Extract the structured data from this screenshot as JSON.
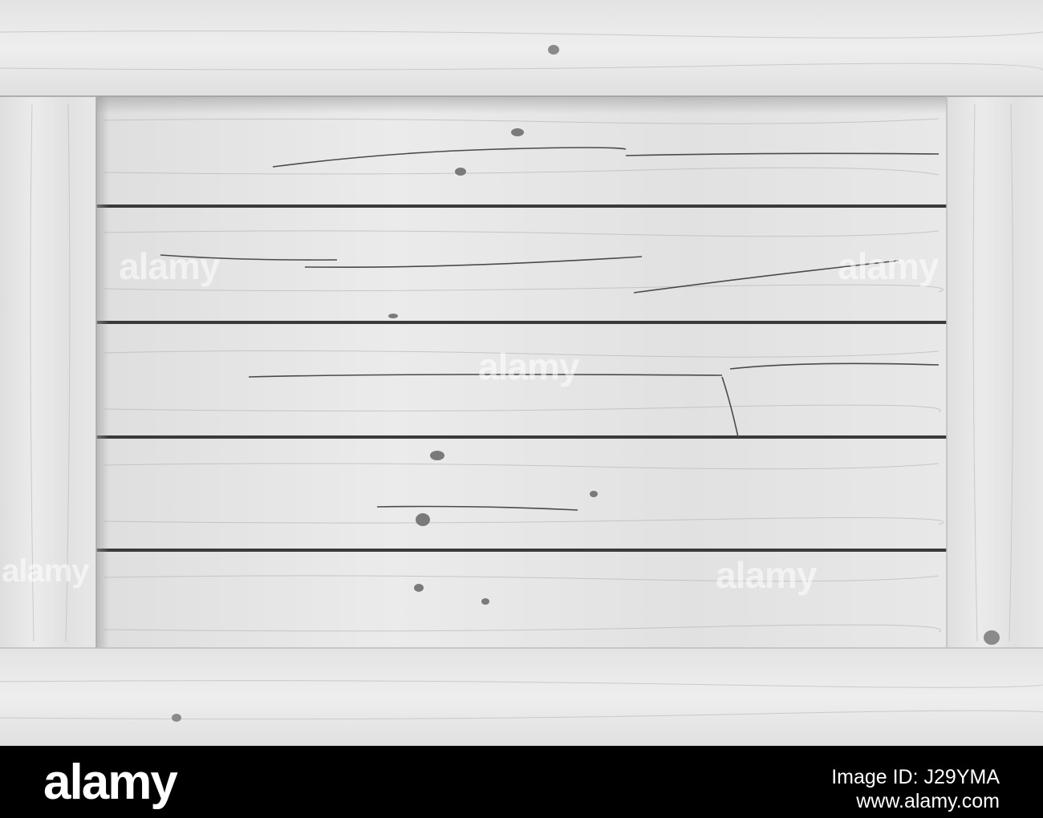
{
  "photo": {
    "subject": "white wooden crate frame",
    "colors": {
      "plank_light": "#e6e6e6",
      "plank_mid": "#d9d9d9",
      "gap_dark": "#3a3a3a",
      "shadow": "#b9b9b9"
    }
  },
  "watermarks": [
    "alamy",
    "alamy",
    "alamy",
    "alamy",
    "alamy"
  ],
  "footer": {
    "logo": "alamy",
    "image_id": "Image ID: J29YMA",
    "url": "www.alamy.com",
    "background": "#000000"
  }
}
